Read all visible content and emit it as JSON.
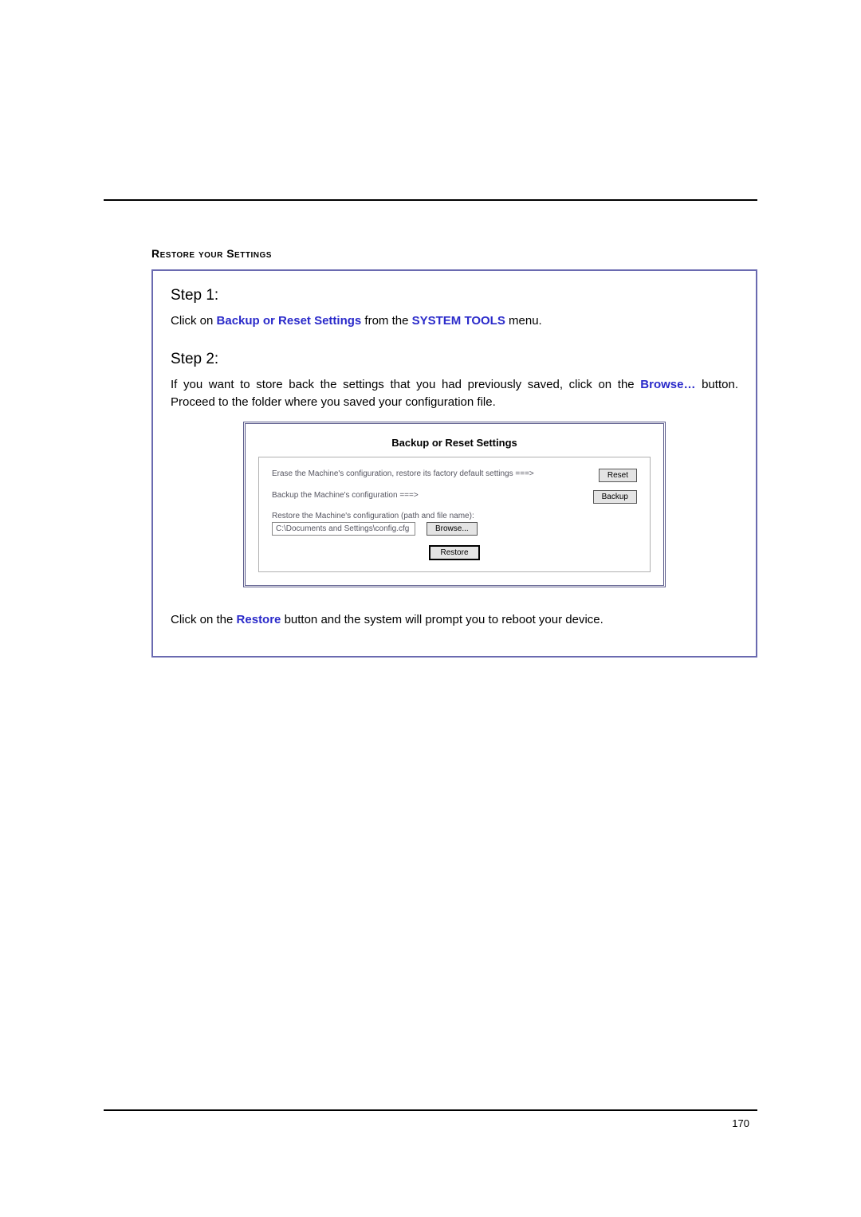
{
  "section_title": "Restore your Settings",
  "step1": {
    "heading": "Step 1:",
    "pre": "Click on ",
    "link": "Backup or Reset Settings",
    "mid": " from the ",
    "menu": "SYSTEM TOOLS",
    "post": " menu."
  },
  "step2": {
    "heading": "Step 2:",
    "pre": "If you want to store back the settings that you had previously saved, click on the ",
    "link": "Browse…",
    "post": " button. Proceed to the folder where you saved your configuration file."
  },
  "panel": {
    "title": "Backup or Reset Settings",
    "row1": "Erase the Machine's configuration, restore its factory default settings ===>",
    "row1_btn": "Reset",
    "row2": "Backup the Machine's configuration ===>",
    "row2_btn": "Backup",
    "row3_top": "Restore the Machine's configuration (path and file name):",
    "path_value": "C:\\Documents and Settings\\config.cfg",
    "browse_btn": "Browse...",
    "restore_btn": "Restore"
  },
  "closing": {
    "pre": "Click on the ",
    "link": "Restore",
    "post": " button and the system will prompt you to reboot your device."
  },
  "page_number": "170"
}
